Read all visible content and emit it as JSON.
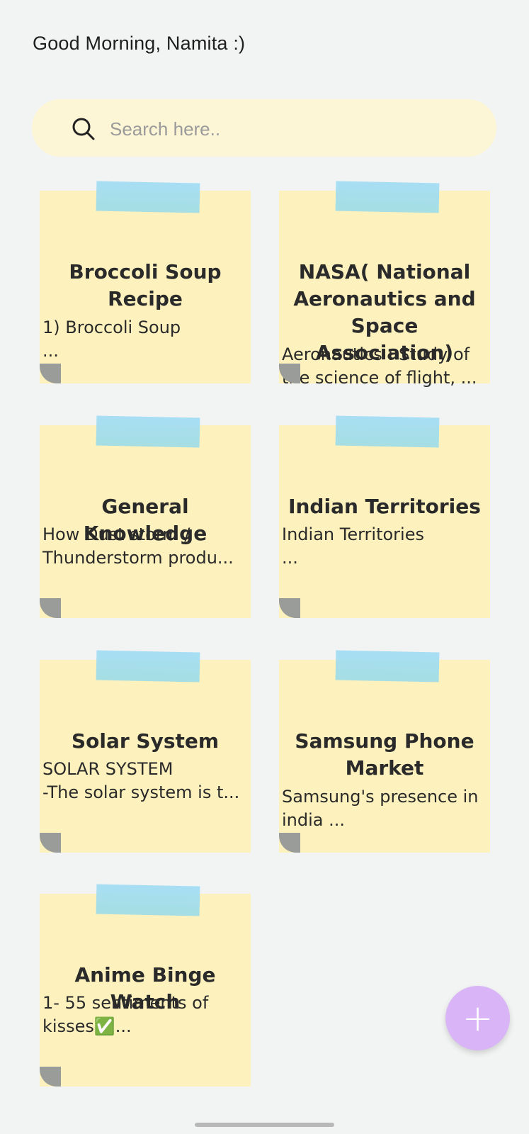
{
  "header": {
    "greeting": "Good Morning, Namita :)"
  },
  "search": {
    "placeholder": "Search here.."
  },
  "notes": [
    {
      "title": "Broccoli Soup\nRecipe",
      "body": "1) Broccoli Soup\n..."
    },
    {
      "title": "NASA( National\nAeronautics and\nSpace Association)",
      "body": "Aeronautics : Study of\nthe science of flight, ..."
    },
    {
      "title": "General Knowledge",
      "body": "How Dust storm /\nThunderstorm produ..."
    },
    {
      "title": "Indian Territories",
      "body": "Indian Territories\n..."
    },
    {
      "title": "Solar System",
      "body": "SOLAR SYSTEM\n-The solar system is  t..."
    },
    {
      "title": "Samsung Phone\nMarket",
      "body": "Samsung's presence in\nindia ..."
    },
    {
      "title": "Anime Binge Watch",
      "body": "1- 55 sentiments of\nkisses✅..."
    }
  ],
  "fab": {
    "label": "+"
  },
  "colors": {
    "note_bg": "#fdf1bd",
    "tape": "#a4ddf4",
    "search_bg": "#fdf6d6",
    "fab": "#d9b5f7"
  }
}
